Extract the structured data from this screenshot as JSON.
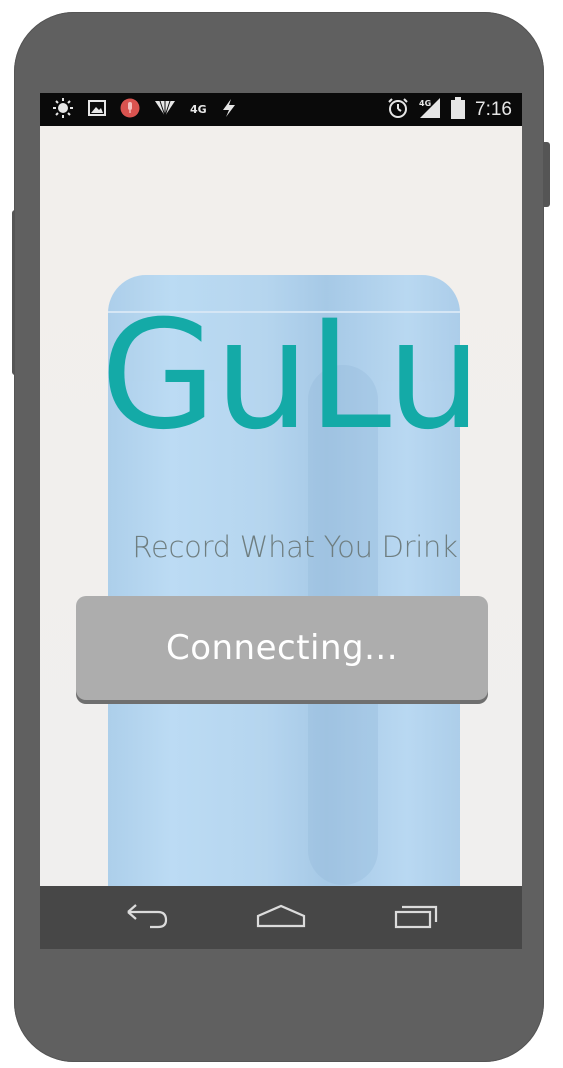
{
  "status_bar": {
    "icons_left": [
      "brightness-icon",
      "image-icon",
      "microphone-icon",
      "signal-icon",
      "network-4g-label",
      "flash-icon"
    ],
    "network_label": "4G",
    "icons_right": [
      "alarm-icon",
      "signal-4g-icon",
      "battery-icon"
    ],
    "time": "7:16"
  },
  "app": {
    "logo": "GuLu",
    "tagline": "Record What You Drink",
    "button_label": "Connecting...",
    "brand_color": "#14aaa7",
    "button_color": "#adadad"
  },
  "nav_bar": {
    "buttons": [
      "back-icon",
      "home-icon",
      "recent-apps-icon"
    ]
  }
}
